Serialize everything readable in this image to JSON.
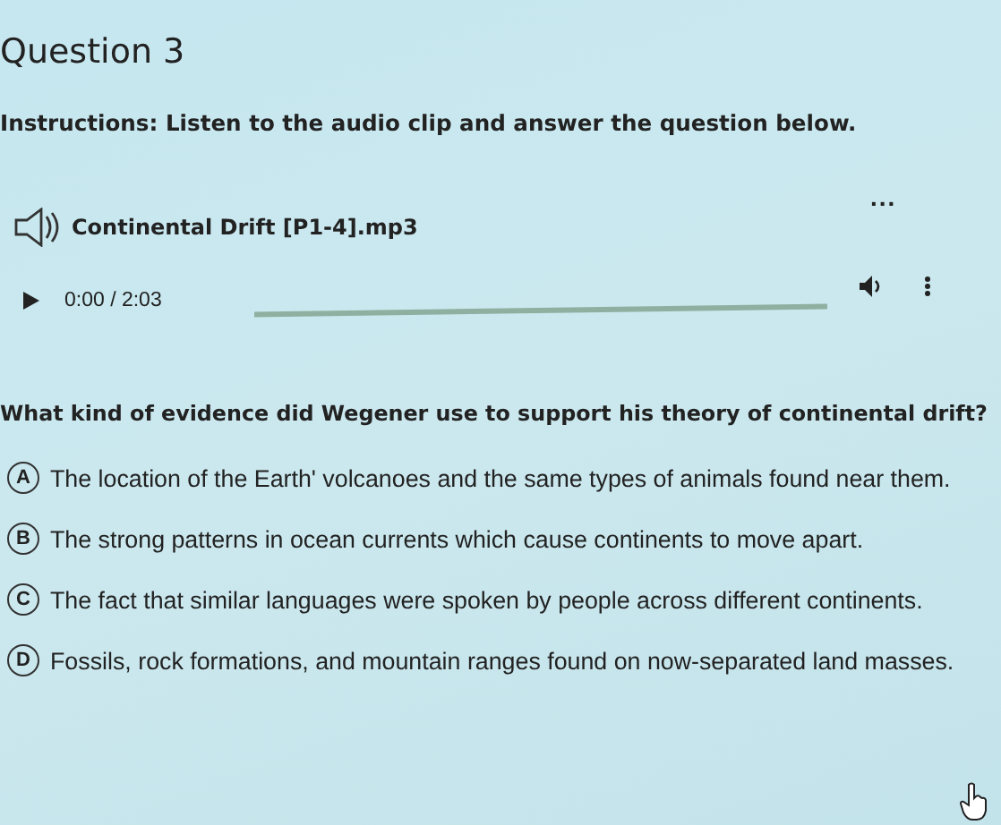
{
  "title": "Question 3",
  "instructions": "Instructions: Listen to the audio clip and answer the question below.",
  "more_menu": "...",
  "audio": {
    "file_name": "Continental Drift [P1-4].mp3",
    "time": "0:00 / 2:03",
    "level": 0
  },
  "question": "What kind of evidence did Wegener use to support his theory of continental drift?",
  "choices": [
    {
      "letter": "A",
      "text": "The location of the Earth' volcanoes and the same types of animals found near them.",
      "selected": false
    },
    {
      "letter": "B",
      "text": "The strong patterns in ocean currents which cause continents to move apart.",
      "selected": false
    },
    {
      "letter": "C",
      "text": "The fact that similar languages were spoken by people across different continents.",
      "selected": false
    },
    {
      "letter": "D",
      "text": "Fossils, rock formations, and mountain ranges found on now-separated land masses.",
      "selected": false
    }
  ]
}
